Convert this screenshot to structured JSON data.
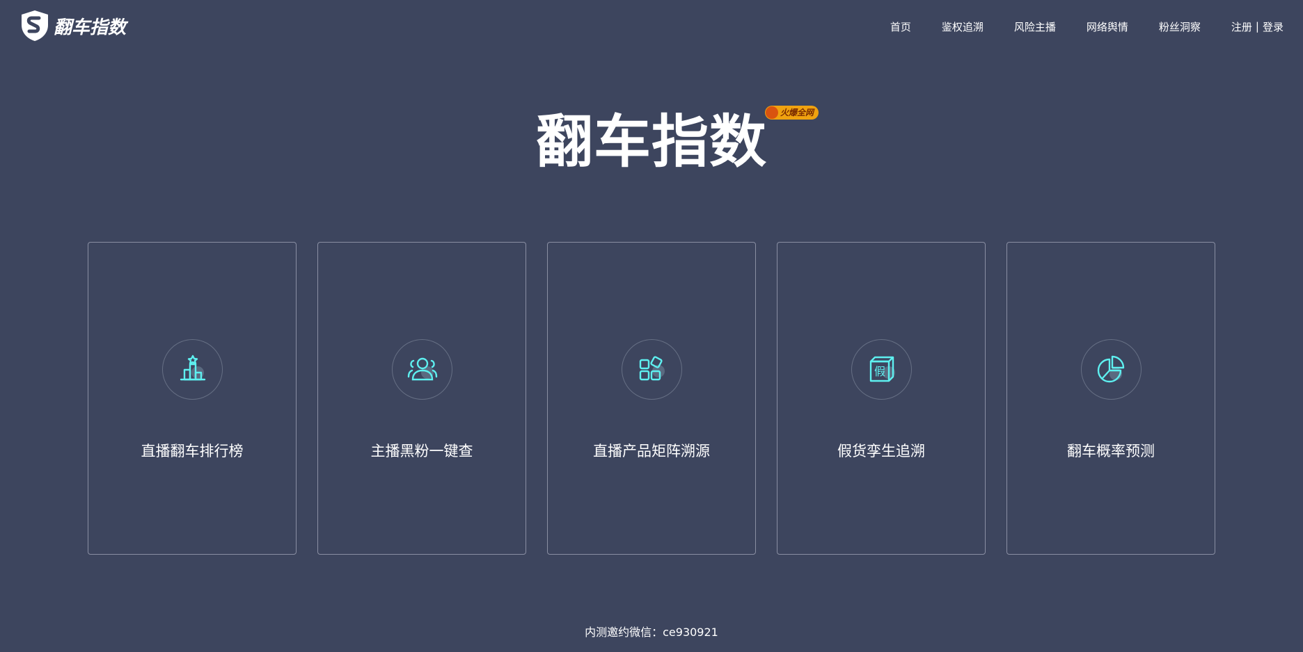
{
  "brand": {
    "name": "翻车指数"
  },
  "nav": {
    "items": [
      "首页",
      "鉴权追溯",
      "风险主播",
      "网络舆情",
      "粉丝洞察"
    ],
    "register": "注册",
    "separator": "|",
    "login": "登录"
  },
  "hero": {
    "title": "翻车指数",
    "badge": "火爆全网"
  },
  "cards": [
    {
      "label": "直播翻车排行榜",
      "icon": "ranking-podium-icon"
    },
    {
      "label": "主播黑粉一键查",
      "icon": "users-group-icon"
    },
    {
      "label": "直播产品矩阵溯源",
      "icon": "apps-grid-icon"
    },
    {
      "label": "假货孪生追溯",
      "icon": "fake-box-icon"
    },
    {
      "label": "翻车概率预测",
      "icon": "pie-chart-icon"
    }
  ],
  "footer": {
    "text": "内测邀约微信：ce930921"
  },
  "colors": {
    "background": "#3d455e",
    "accent": "#5ef0f0",
    "badge": "#f0a20f"
  }
}
